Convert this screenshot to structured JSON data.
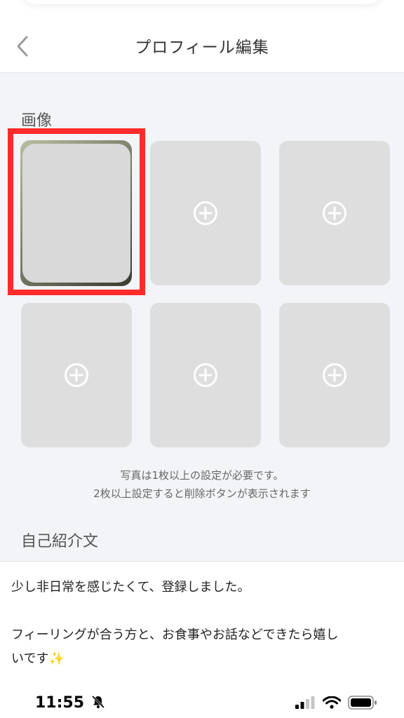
{
  "header": {
    "title": "プロフィール編集",
    "back_icon": "chevron-left-icon"
  },
  "photos": {
    "section_label": "画像",
    "slots": [
      {
        "state": "filled"
      },
      {
        "state": "empty",
        "icon": "add-circle-icon"
      },
      {
        "state": "empty",
        "icon": "add-circle-icon"
      },
      {
        "state": "empty",
        "icon": "add-circle-icon"
      },
      {
        "state": "empty",
        "icon": "add-circle-icon"
      },
      {
        "state": "empty",
        "icon": "add-circle-icon"
      }
    ],
    "notice_line1": "写真は1枚以上の設定が必要です。",
    "notice_line2": "2枚以上設定すると削除ボタンが表示されます",
    "highlight_color": "#ff2b2b"
  },
  "bio": {
    "section_label": "自己紹介文",
    "line1": "少し非日常を感じたくて、登録しました。",
    "line2": "フィーリングが合う方と、お食事やお話などできたら嬉し",
    "line3": "いです✨"
  },
  "status_bar": {
    "time": "11:55",
    "icons": [
      "bell-slash-icon",
      "signal-icon",
      "wifi-icon",
      "battery-icon"
    ]
  },
  "colors": {
    "background": "#f2f4f7",
    "slot_empty": "#dedede",
    "highlight": "#ff2b2b"
  }
}
